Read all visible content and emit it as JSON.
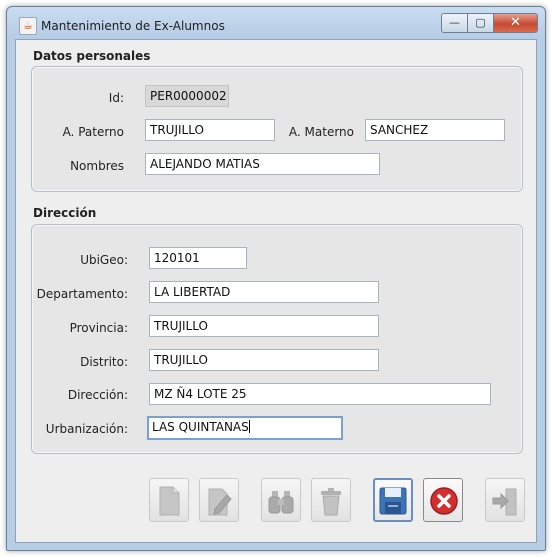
{
  "window": {
    "title": "Mantenimiento de Ex-Alumnos",
    "app_icon": "java-cup-icon",
    "controls": {
      "minimize": "—",
      "maximize": "▢",
      "close": "✕"
    }
  },
  "datos_personales": {
    "title": "Datos personales",
    "id": {
      "label": "Id:",
      "value": "PER0000002"
    },
    "a_paterno": {
      "label": "A. Paterno",
      "value": "TRUJILLO"
    },
    "a_materno": {
      "label": "A. Materno",
      "value": "SANCHEZ"
    },
    "nombres": {
      "label": "Nombres",
      "value": "ALEJANDO MATIAS"
    }
  },
  "direccion": {
    "title": "Dirección",
    "ubigeo": {
      "label": "UbiGeo:",
      "value": "120101"
    },
    "departamento": {
      "label": "Departamento:",
      "value": "LA LIBERTAD"
    },
    "provincia": {
      "label": "Provincia:",
      "value": "TRUJILLO"
    },
    "distrito": {
      "label": "Distrito:",
      "value": "TRUJILLO"
    },
    "direccion": {
      "label": "Dirección:",
      "value": "MZ Ñ4 LOTE 25"
    },
    "urbanizacion": {
      "label": "Urbanización:",
      "value": "LAS QUINTANAS"
    }
  },
  "toolbar": {
    "buttons": [
      {
        "icon": "new-document-icon",
        "enabled": false
      },
      {
        "icon": "edit-pencil-icon",
        "enabled": false
      },
      {
        "icon": "binoculars-search-icon",
        "enabled": false
      },
      {
        "icon": "trash-can-icon",
        "enabled": false
      },
      {
        "icon": "floppy-disk-save-icon",
        "enabled": true
      },
      {
        "icon": "red-cancel-icon",
        "enabled": true
      },
      {
        "icon": "exit-door-icon",
        "enabled": false
      }
    ]
  },
  "colors": {
    "save_blue": "#3f73b8",
    "cancel_red": "#d32f2f",
    "disabled_gray": "#bdbdbd"
  }
}
